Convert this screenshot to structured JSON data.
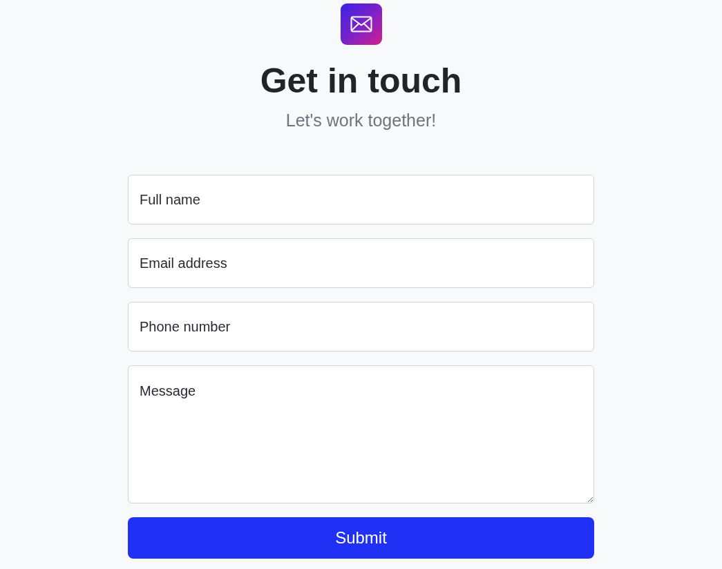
{
  "header": {
    "title": "Get in touch",
    "subtitle": "Let's work together!"
  },
  "form": {
    "fields": [
      {
        "kind": "input",
        "placeholder": "Full name"
      },
      {
        "kind": "input",
        "placeholder": "Email address"
      },
      {
        "kind": "input",
        "placeholder": "Phone number"
      },
      {
        "kind": "textarea",
        "placeholder": "Message"
      }
    ],
    "submit": {
      "label": "Submit"
    }
  }
}
